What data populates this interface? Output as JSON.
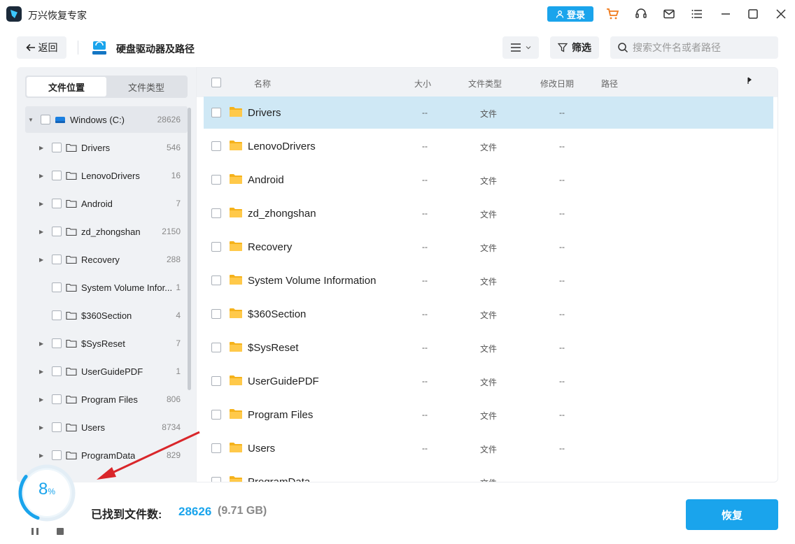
{
  "app": {
    "title": "万兴恢复专家"
  },
  "titlebar": {
    "login_label": "登录",
    "icons": [
      "cart-icon",
      "headset-icon",
      "mail-icon",
      "menu-icon",
      "minimize-icon",
      "maximize-icon",
      "close-icon"
    ]
  },
  "toolbar": {
    "back_label": "返回",
    "page_title": "硬盘驱动器及路径",
    "filter_label": "筛选",
    "search_placeholder": "搜索文件名或者路径"
  },
  "sidebar": {
    "tabs": [
      {
        "label": "文件位置",
        "active": true
      },
      {
        "label": "文件类型",
        "active": false
      }
    ],
    "root": {
      "label": "Windows (C:)",
      "count": "28626"
    },
    "items": [
      {
        "label": "Drivers",
        "count": "546",
        "expandable": true
      },
      {
        "label": "LenovoDrivers",
        "count": "16",
        "expandable": true
      },
      {
        "label": "Android",
        "count": "7",
        "expandable": true
      },
      {
        "label": "zd_zhongshan",
        "count": "2150",
        "expandable": true
      },
      {
        "label": "Recovery",
        "count": "288",
        "expandable": true
      },
      {
        "label": "System Volume Infor...",
        "count": "1",
        "expandable": false
      },
      {
        "label": "$360Section",
        "count": "4",
        "expandable": false
      },
      {
        "label": "$SysReset",
        "count": "7",
        "expandable": true
      },
      {
        "label": "UserGuidePDF",
        "count": "1",
        "expandable": true
      },
      {
        "label": "Program Files",
        "count": "806",
        "expandable": true
      },
      {
        "label": "Users",
        "count": "8734",
        "expandable": true
      },
      {
        "label": "ProgramData",
        "count": "829",
        "expandable": true
      }
    ]
  },
  "table": {
    "headers": {
      "name": "名称",
      "size": "大小",
      "type": "文件类型",
      "date": "修改日期",
      "path": "路径"
    },
    "rows": [
      {
        "name": "Drivers",
        "size": "--",
        "type": "文件",
        "date": "--",
        "selected": true
      },
      {
        "name": "LenovoDrivers",
        "size": "--",
        "type": "文件",
        "date": "--"
      },
      {
        "name": "Android",
        "size": "--",
        "type": "文件",
        "date": "--"
      },
      {
        "name": "zd_zhongshan",
        "size": "--",
        "type": "文件",
        "date": "--"
      },
      {
        "name": "Recovery",
        "size": "--",
        "type": "文件",
        "date": "--"
      },
      {
        "name": "System Volume Information",
        "size": "--",
        "type": "文件",
        "date": "--"
      },
      {
        "name": "$360Section",
        "size": "--",
        "type": "文件",
        "date": "--"
      },
      {
        "name": "$SysReset",
        "size": "--",
        "type": "文件",
        "date": "--"
      },
      {
        "name": "UserGuidePDF",
        "size": "--",
        "type": "文件",
        "date": "--"
      },
      {
        "name": "Program Files",
        "size": "--",
        "type": "文件",
        "date": "--"
      },
      {
        "name": "Users",
        "size": "--",
        "type": "文件",
        "date": "--"
      },
      {
        "name": "ProgramData",
        "size": "--",
        "type": "文件",
        "date": "--"
      }
    ]
  },
  "status": {
    "progress_value": "8",
    "progress_unit": "%",
    "progress_fraction": 0.08,
    "found_label": "已找到文件数:",
    "found_count": "28626",
    "found_size": "(9.71 GB)",
    "recover_label": "恢复"
  },
  "colors": {
    "accent": "#1aa4ec",
    "folder": "#f5b21b",
    "selected_row": "#cfe8f5",
    "annotation_arrow": "#d9262a"
  }
}
